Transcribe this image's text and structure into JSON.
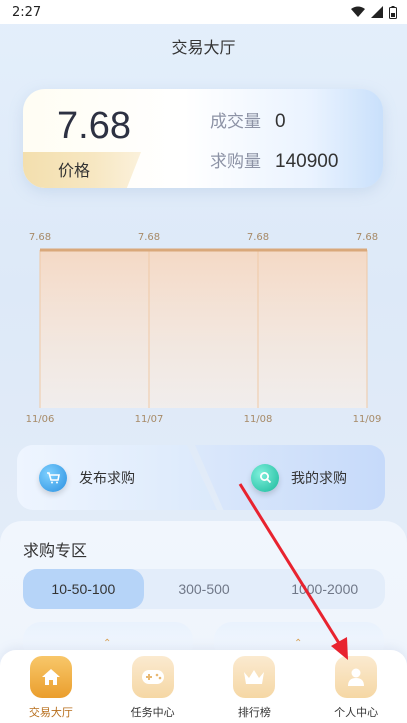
{
  "status_bar": {
    "time": "2:27"
  },
  "header": {
    "title": "交易大厅"
  },
  "price_card": {
    "price": "7.68",
    "price_label": "价格",
    "volume_label": "成交量",
    "volume_value": "0",
    "demand_label": "求购量",
    "demand_value": "140900"
  },
  "chart_data": {
    "type": "area",
    "x": [
      "11/06",
      "11/07",
      "11/08",
      "11/09"
    ],
    "series": [
      {
        "values": [
          7.68,
          7.68,
          7.68,
          7.68
        ]
      }
    ],
    "data_labels": [
      "7.68",
      "7.68",
      "7.68",
      "7.68"
    ],
    "colors": {
      "line": "#d9a87a",
      "fill_top": "#f4d9c5",
      "fill_bottom": "#fcefe4",
      "label": "#a78a67"
    }
  },
  "actions": {
    "publish_label": "发布求购",
    "mine_label": "我的求购"
  },
  "purchase_zone": {
    "title": "求购专区",
    "tabs": [
      "10-50-100",
      "300-500",
      "1000-2000"
    ],
    "active_tab": 0
  },
  "nav": {
    "items": [
      {
        "label": "交易大厅",
        "icon": "home-icon"
      },
      {
        "label": "任务中心",
        "icon": "gamepad-icon"
      },
      {
        "label": "排行榜",
        "icon": "crown-icon"
      },
      {
        "label": "个人中心",
        "icon": "user-icon"
      }
    ],
    "active": 0
  },
  "colors": {
    "accent": "#ea9e2d",
    "arrow": "#e8232f"
  }
}
